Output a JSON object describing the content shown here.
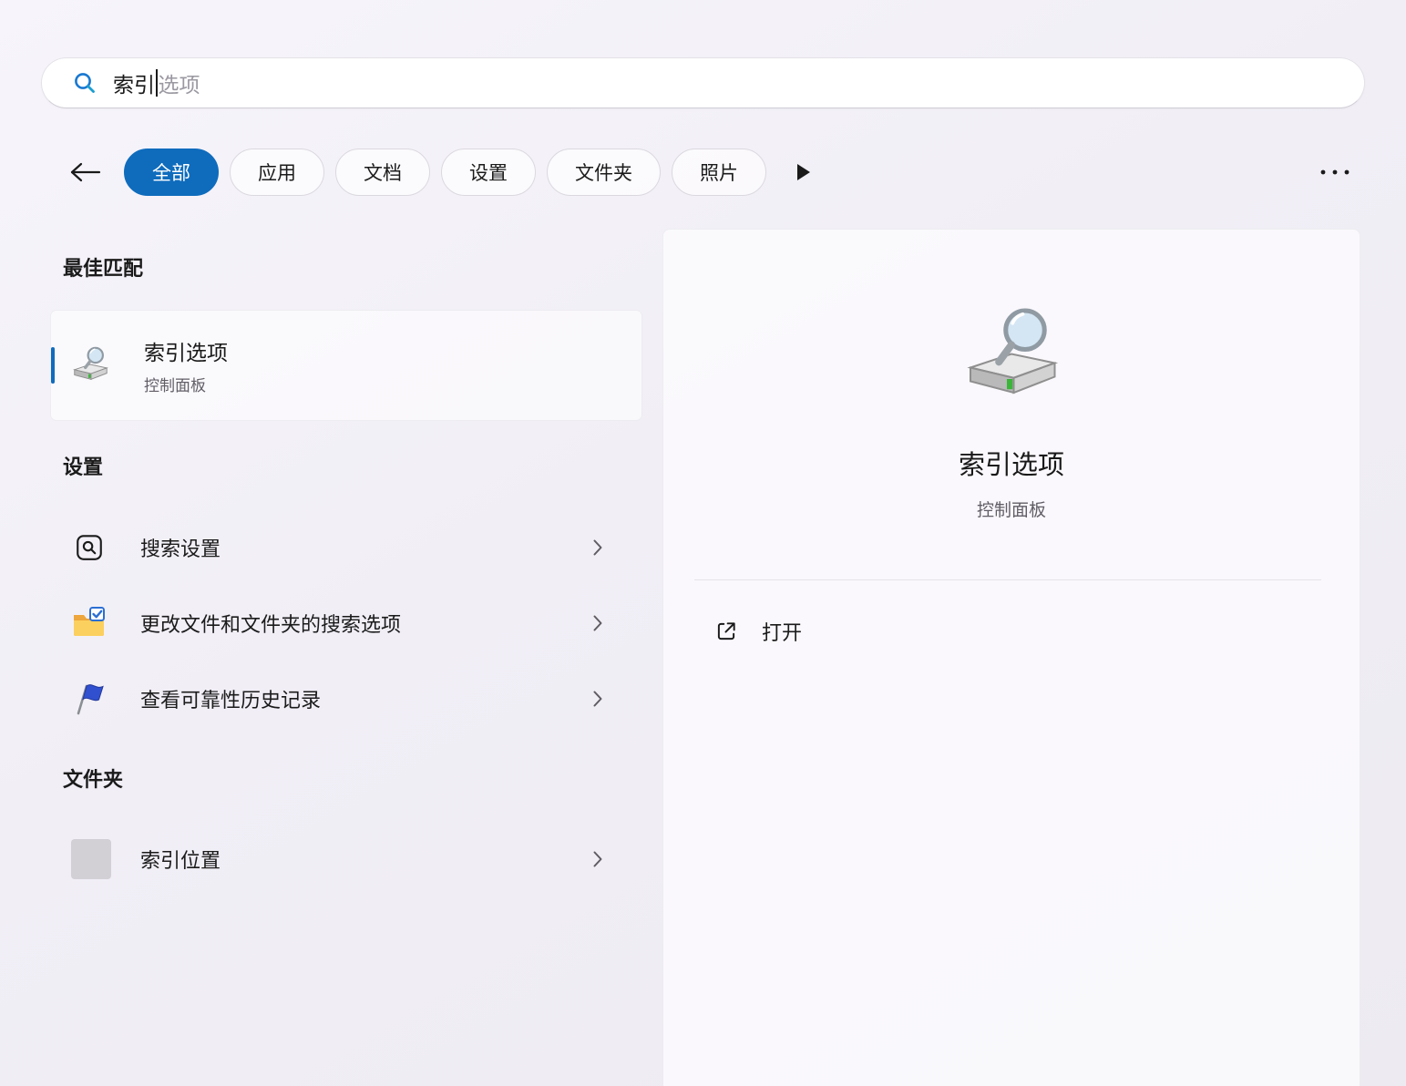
{
  "search": {
    "value": "索引",
    "suggestion": "选项",
    "icon": "search-icon"
  },
  "filter_bar": {
    "back_icon": "back-arrow-icon",
    "pills": [
      {
        "label": "全部",
        "selected": true
      },
      {
        "label": "应用",
        "selected": false
      },
      {
        "label": "文档",
        "selected": false
      },
      {
        "label": "设置",
        "selected": false
      },
      {
        "label": "文件夹",
        "selected": false
      },
      {
        "label": "照片",
        "selected": false
      }
    ],
    "expand_icon": "play-icon",
    "more_icon": "ellipsis-icon"
  },
  "results": {
    "best_match": {
      "heading": "最佳匹配",
      "title": "索引选项",
      "subtitle": "控制面板",
      "icon": "indexing-options-icon"
    },
    "settings_section": {
      "heading": "设置",
      "items": [
        {
          "label": "搜索设置",
          "icon": "search-settings-icon"
        },
        {
          "label": "更改文件和文件夹的搜索选项",
          "icon": "folder-search-options-icon"
        },
        {
          "label": "查看可靠性历史记录",
          "icon": "reliability-flag-icon"
        }
      ]
    },
    "folders_section": {
      "heading": "文件夹",
      "items": [
        {
          "label": "索引位置",
          "icon": "folder-placeholder-icon"
        }
      ]
    }
  },
  "preview": {
    "title": "索引选项",
    "subtitle": "控制面板",
    "icon": "indexing-options-icon",
    "open_action": {
      "label": "打开",
      "icon": "open-external-icon"
    }
  },
  "colors": {
    "accent": "#0F6CBD",
    "background_top": "#f7f5fb",
    "background_bottom": "#edebf1"
  }
}
